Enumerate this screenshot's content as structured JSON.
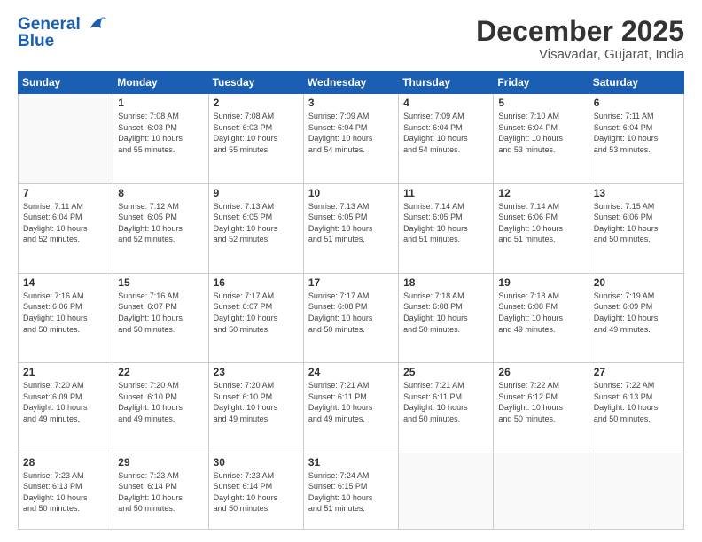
{
  "header": {
    "logo_line1": "General",
    "logo_line2": "Blue",
    "month": "December 2025",
    "location": "Visavadar, Gujarat, India"
  },
  "days_of_week": [
    "Sunday",
    "Monday",
    "Tuesday",
    "Wednesday",
    "Thursday",
    "Friday",
    "Saturday"
  ],
  "weeks": [
    [
      {
        "day": "",
        "info": ""
      },
      {
        "day": "1",
        "info": "Sunrise: 7:08 AM\nSunset: 6:03 PM\nDaylight: 10 hours\nand 55 minutes."
      },
      {
        "day": "2",
        "info": "Sunrise: 7:08 AM\nSunset: 6:03 PM\nDaylight: 10 hours\nand 55 minutes."
      },
      {
        "day": "3",
        "info": "Sunrise: 7:09 AM\nSunset: 6:04 PM\nDaylight: 10 hours\nand 54 minutes."
      },
      {
        "day": "4",
        "info": "Sunrise: 7:09 AM\nSunset: 6:04 PM\nDaylight: 10 hours\nand 54 minutes."
      },
      {
        "day": "5",
        "info": "Sunrise: 7:10 AM\nSunset: 6:04 PM\nDaylight: 10 hours\nand 53 minutes."
      },
      {
        "day": "6",
        "info": "Sunrise: 7:11 AM\nSunset: 6:04 PM\nDaylight: 10 hours\nand 53 minutes."
      }
    ],
    [
      {
        "day": "7",
        "info": "Sunrise: 7:11 AM\nSunset: 6:04 PM\nDaylight: 10 hours\nand 52 minutes."
      },
      {
        "day": "8",
        "info": "Sunrise: 7:12 AM\nSunset: 6:05 PM\nDaylight: 10 hours\nand 52 minutes."
      },
      {
        "day": "9",
        "info": "Sunrise: 7:13 AM\nSunset: 6:05 PM\nDaylight: 10 hours\nand 52 minutes."
      },
      {
        "day": "10",
        "info": "Sunrise: 7:13 AM\nSunset: 6:05 PM\nDaylight: 10 hours\nand 51 minutes."
      },
      {
        "day": "11",
        "info": "Sunrise: 7:14 AM\nSunset: 6:05 PM\nDaylight: 10 hours\nand 51 minutes."
      },
      {
        "day": "12",
        "info": "Sunrise: 7:14 AM\nSunset: 6:06 PM\nDaylight: 10 hours\nand 51 minutes."
      },
      {
        "day": "13",
        "info": "Sunrise: 7:15 AM\nSunset: 6:06 PM\nDaylight: 10 hours\nand 50 minutes."
      }
    ],
    [
      {
        "day": "14",
        "info": "Sunrise: 7:16 AM\nSunset: 6:06 PM\nDaylight: 10 hours\nand 50 minutes."
      },
      {
        "day": "15",
        "info": "Sunrise: 7:16 AM\nSunset: 6:07 PM\nDaylight: 10 hours\nand 50 minutes."
      },
      {
        "day": "16",
        "info": "Sunrise: 7:17 AM\nSunset: 6:07 PM\nDaylight: 10 hours\nand 50 minutes."
      },
      {
        "day": "17",
        "info": "Sunrise: 7:17 AM\nSunset: 6:08 PM\nDaylight: 10 hours\nand 50 minutes."
      },
      {
        "day": "18",
        "info": "Sunrise: 7:18 AM\nSunset: 6:08 PM\nDaylight: 10 hours\nand 50 minutes."
      },
      {
        "day": "19",
        "info": "Sunrise: 7:18 AM\nSunset: 6:08 PM\nDaylight: 10 hours\nand 49 minutes."
      },
      {
        "day": "20",
        "info": "Sunrise: 7:19 AM\nSunset: 6:09 PM\nDaylight: 10 hours\nand 49 minutes."
      }
    ],
    [
      {
        "day": "21",
        "info": "Sunrise: 7:20 AM\nSunset: 6:09 PM\nDaylight: 10 hours\nand 49 minutes."
      },
      {
        "day": "22",
        "info": "Sunrise: 7:20 AM\nSunset: 6:10 PM\nDaylight: 10 hours\nand 49 minutes."
      },
      {
        "day": "23",
        "info": "Sunrise: 7:20 AM\nSunset: 6:10 PM\nDaylight: 10 hours\nand 49 minutes."
      },
      {
        "day": "24",
        "info": "Sunrise: 7:21 AM\nSunset: 6:11 PM\nDaylight: 10 hours\nand 49 minutes."
      },
      {
        "day": "25",
        "info": "Sunrise: 7:21 AM\nSunset: 6:11 PM\nDaylight: 10 hours\nand 50 minutes."
      },
      {
        "day": "26",
        "info": "Sunrise: 7:22 AM\nSunset: 6:12 PM\nDaylight: 10 hours\nand 50 minutes."
      },
      {
        "day": "27",
        "info": "Sunrise: 7:22 AM\nSunset: 6:13 PM\nDaylight: 10 hours\nand 50 minutes."
      }
    ],
    [
      {
        "day": "28",
        "info": "Sunrise: 7:23 AM\nSunset: 6:13 PM\nDaylight: 10 hours\nand 50 minutes."
      },
      {
        "day": "29",
        "info": "Sunrise: 7:23 AM\nSunset: 6:14 PM\nDaylight: 10 hours\nand 50 minutes."
      },
      {
        "day": "30",
        "info": "Sunrise: 7:23 AM\nSunset: 6:14 PM\nDaylight: 10 hours\nand 50 minutes."
      },
      {
        "day": "31",
        "info": "Sunrise: 7:24 AM\nSunset: 6:15 PM\nDaylight: 10 hours\nand 51 minutes."
      },
      {
        "day": "",
        "info": ""
      },
      {
        "day": "",
        "info": ""
      },
      {
        "day": "",
        "info": ""
      }
    ]
  ]
}
